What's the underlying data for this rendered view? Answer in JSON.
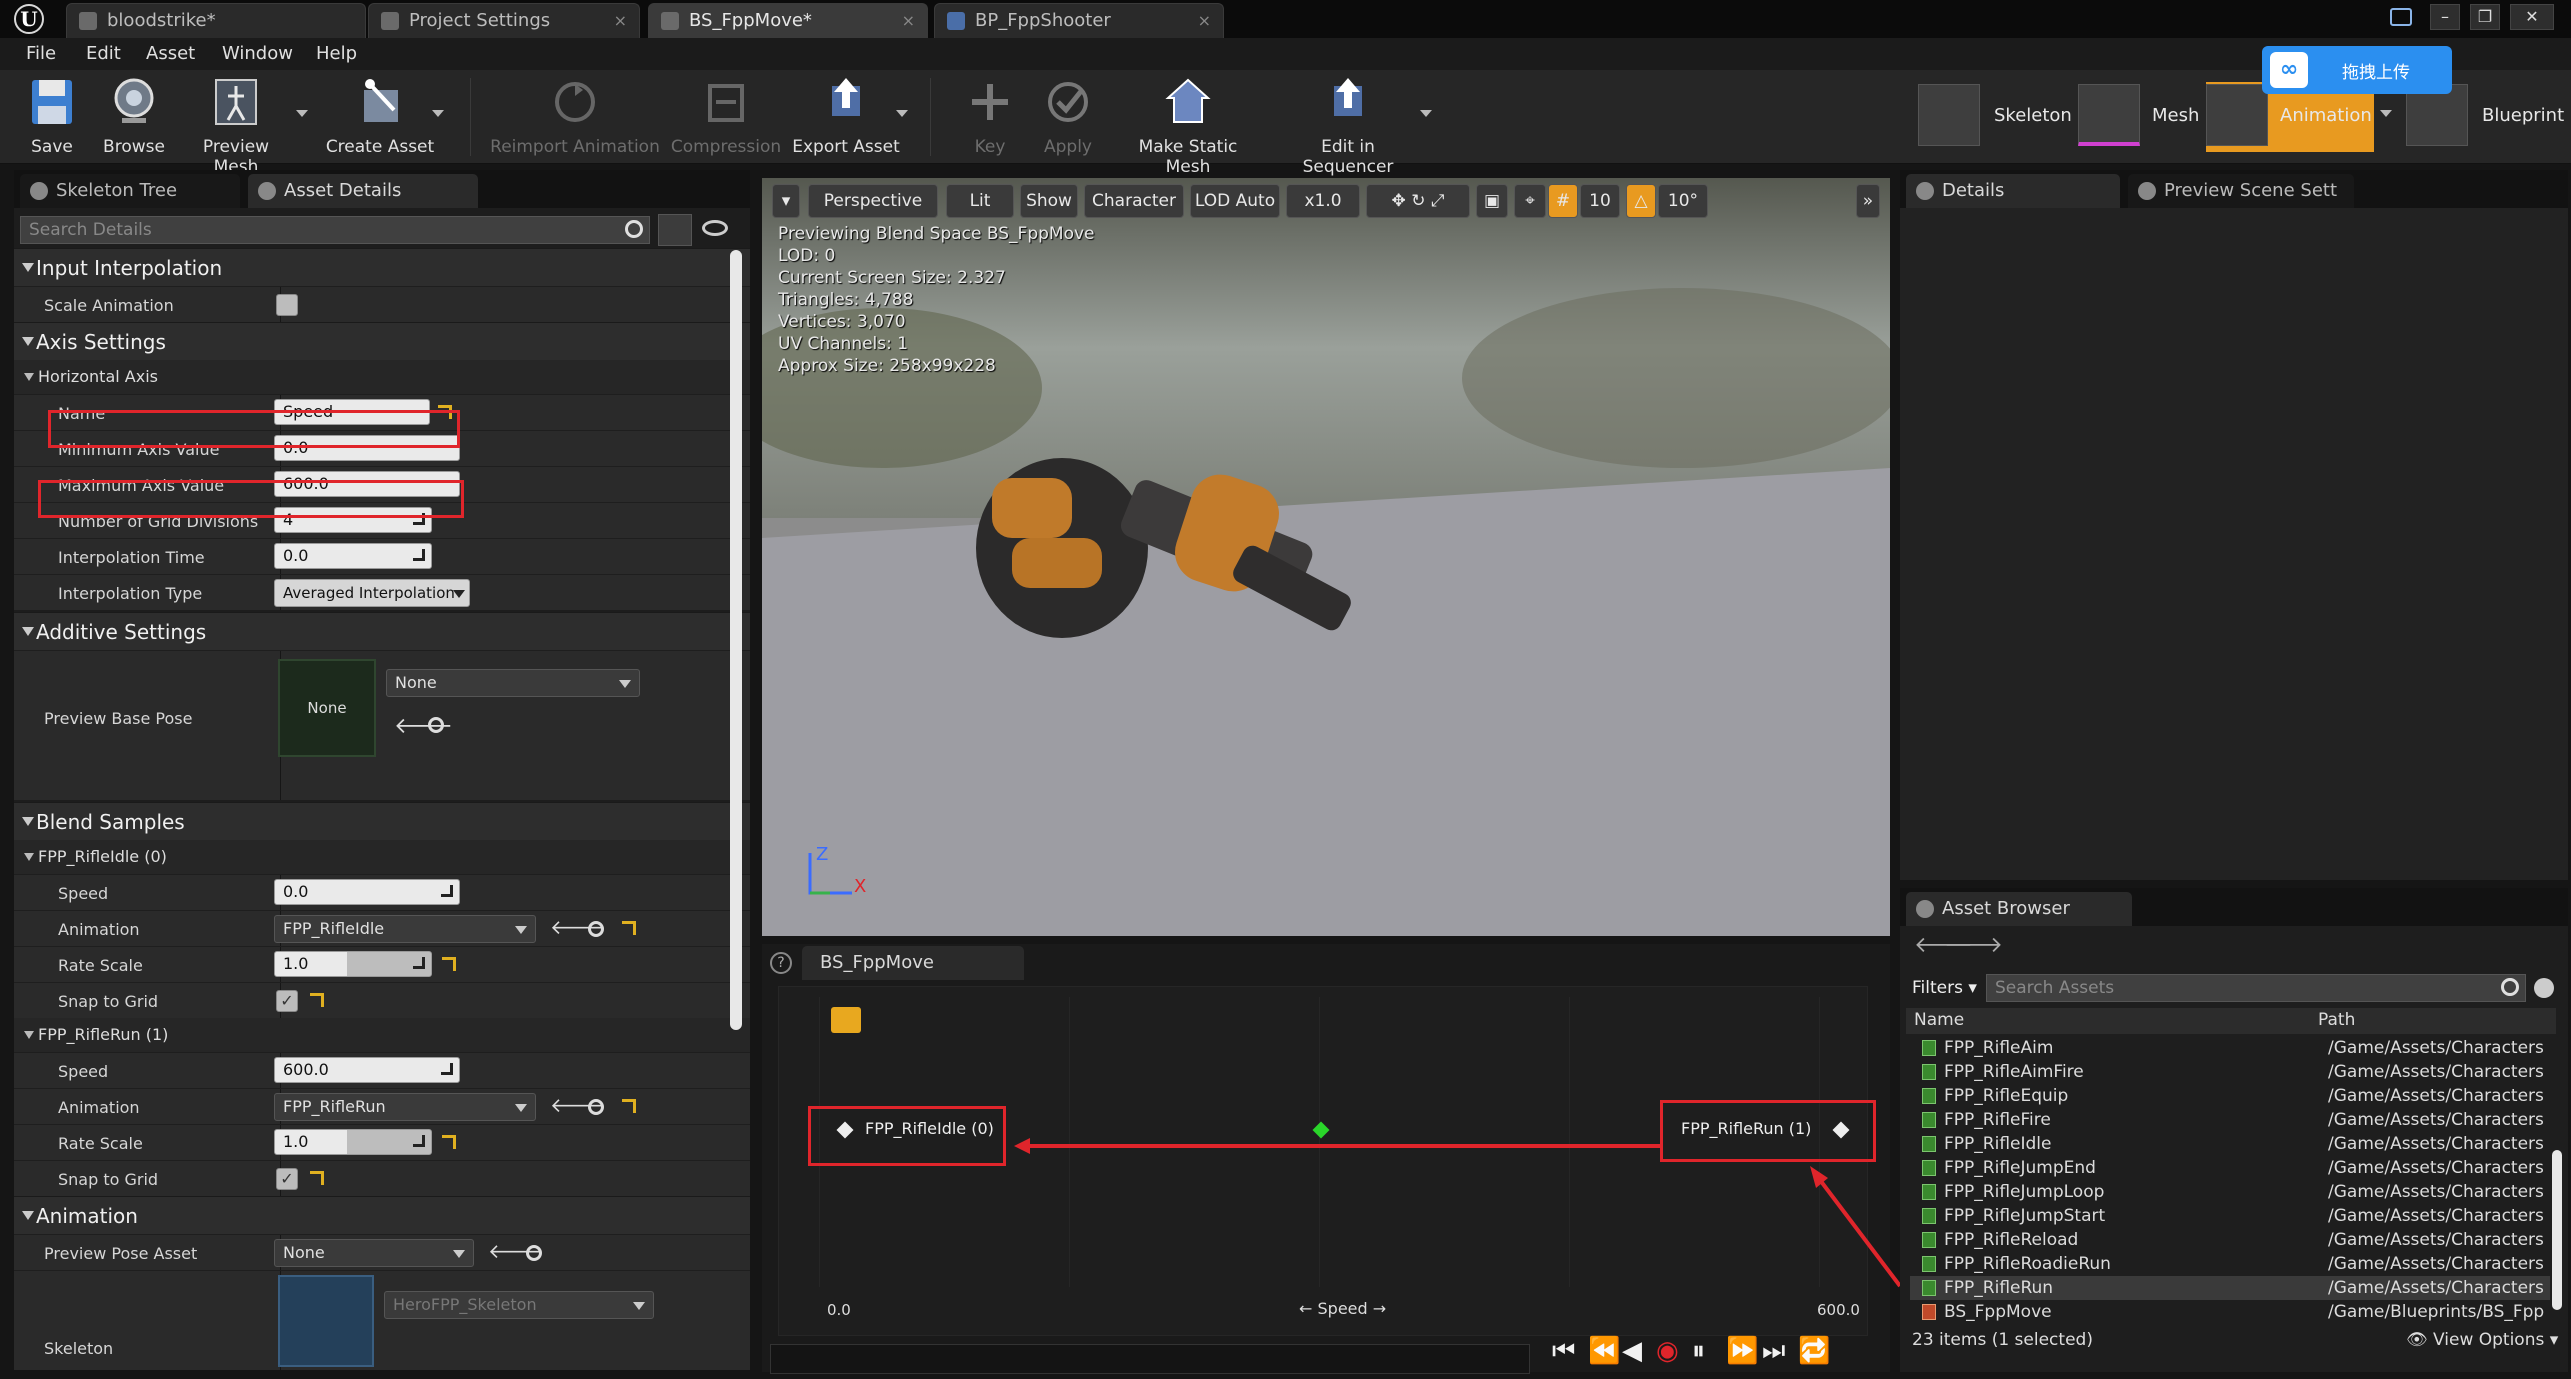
{
  "tabs": [
    "bloodstrike*",
    "Project Settings",
    "BS_FppMove*",
    "BP_FppShooter"
  ],
  "menu": [
    "File",
    "Edit",
    "Asset",
    "Window",
    "Help"
  ],
  "toolbar": {
    "save": "Save",
    "browse": "Browse",
    "preview_mesh": "Preview Mesh",
    "create_asset": "Create Asset",
    "reimport": "Reimport Animation",
    "compression": "Compression",
    "export": "Export Asset",
    "key": "Key",
    "apply": "Apply",
    "make_static": "Make Static Mesh",
    "sequencer": "Edit in Sequencer"
  },
  "modes": [
    "Skeleton",
    "Mesh",
    "Animation",
    "Blueprint"
  ],
  "cloud_upload": "拖拽上传",
  "left_tabs": [
    "Skeleton Tree",
    "Asset Details"
  ],
  "search_details_placeholder": "Search Details",
  "details": {
    "input_interpolation": "Input Interpolation",
    "scale_animation": "Scale Animation",
    "axis_settings": "Axis Settings",
    "horizontal_axis": "Horizontal Axis",
    "name_label": "Name",
    "name_value": "Speed",
    "min_label": "Minimum Axis Value",
    "min_value": "0.0",
    "max_label": "Maximum Axis Value",
    "max_value": "600.0",
    "grid_label": "Number of Grid Divisions",
    "grid_value": "4",
    "interp_time_label": "Interpolation Time",
    "interp_time_value": "0.0",
    "interp_type_label": "Interpolation Type",
    "interp_type_value": "Averaged Interpolation",
    "additive_settings": "Additive Settings",
    "preview_base_pose": "Preview Base Pose",
    "none": "None",
    "blend_samples": "Blend Samples",
    "sample0": "FPP_RifleIdle (0)",
    "sample1": "FPP_RifleRun (1)",
    "speed": "Speed",
    "animation": "Animation",
    "rate_scale": "Rate Scale",
    "snap": "Snap to Grid",
    "s0_speed": "0.0",
    "s0_anim": "FPP_RifleIdle",
    "s0_rate": "1.0",
    "s1_speed": "600.0",
    "s1_anim": "FPP_RifleRun",
    "s1_rate": "1.0",
    "animation_cat": "Animation",
    "preview_pose_asset": "Preview Pose Asset",
    "skeleton": "Skeleton",
    "skeleton_value": "HeroFPP_Skeleton"
  },
  "viewport": {
    "buttons": [
      "Perspective",
      "Lit",
      "Show",
      "Character",
      "LOD Auto",
      "x1.0",
      "10",
      "10°"
    ],
    "stats": [
      "Previewing Blend Space BS_FppMove",
      "LOD: 0",
      "Current Screen Size: 2.327",
      "Triangles: 4,788",
      "Vertices: 3,070",
      "UV Channels: 1",
      "Approx Size: 258x99x228"
    ],
    "axis_z": "Z",
    "axis_x": "X"
  },
  "blend_editor": {
    "tab": "BS_FppMove",
    "left_sample": "FPP_RifleIdle (0)",
    "right_sample": "FPP_RifleRun (1)",
    "x_min": "0.0",
    "x_max": "600.0",
    "x_label": "Speed"
  },
  "right_tabs": [
    "Details",
    "Preview Scene Sett"
  ],
  "asset_browser": {
    "tab": "Asset Browser",
    "filters": "Filters",
    "search_placeholder": "Search Assets",
    "col_name": "Name",
    "col_path": "Path",
    "rows": [
      {
        "name": "FPP_RifleAim",
        "path": "/Game/Assets/Characters"
      },
      {
        "name": "FPP_RifleAimFire",
        "path": "/Game/Assets/Characters"
      },
      {
        "name": "FPP_RifleEquip",
        "path": "/Game/Assets/Characters"
      },
      {
        "name": "FPP_RifleFire",
        "path": "/Game/Assets/Characters"
      },
      {
        "name": "FPP_RifleIdle",
        "path": "/Game/Assets/Characters"
      },
      {
        "name": "FPP_RifleJumpEnd",
        "path": "/Game/Assets/Characters"
      },
      {
        "name": "FPP_RifleJumpLoop",
        "path": "/Game/Assets/Characters"
      },
      {
        "name": "FPP_RifleJumpStart",
        "path": "/Game/Assets/Characters"
      },
      {
        "name": "FPP_RifleReload",
        "path": "/Game/Assets/Characters"
      },
      {
        "name": "FPP_RifleRoadieRun",
        "path": "/Game/Assets/Characters"
      },
      {
        "name": "FPP_RifleRun",
        "path": "/Game/Assets/Characters"
      },
      {
        "name": "BS_FppMove",
        "path": "/Game/Blueprints/BS_Fpp"
      }
    ],
    "status": "23 items (1 selected)",
    "view_options": "View Options"
  }
}
